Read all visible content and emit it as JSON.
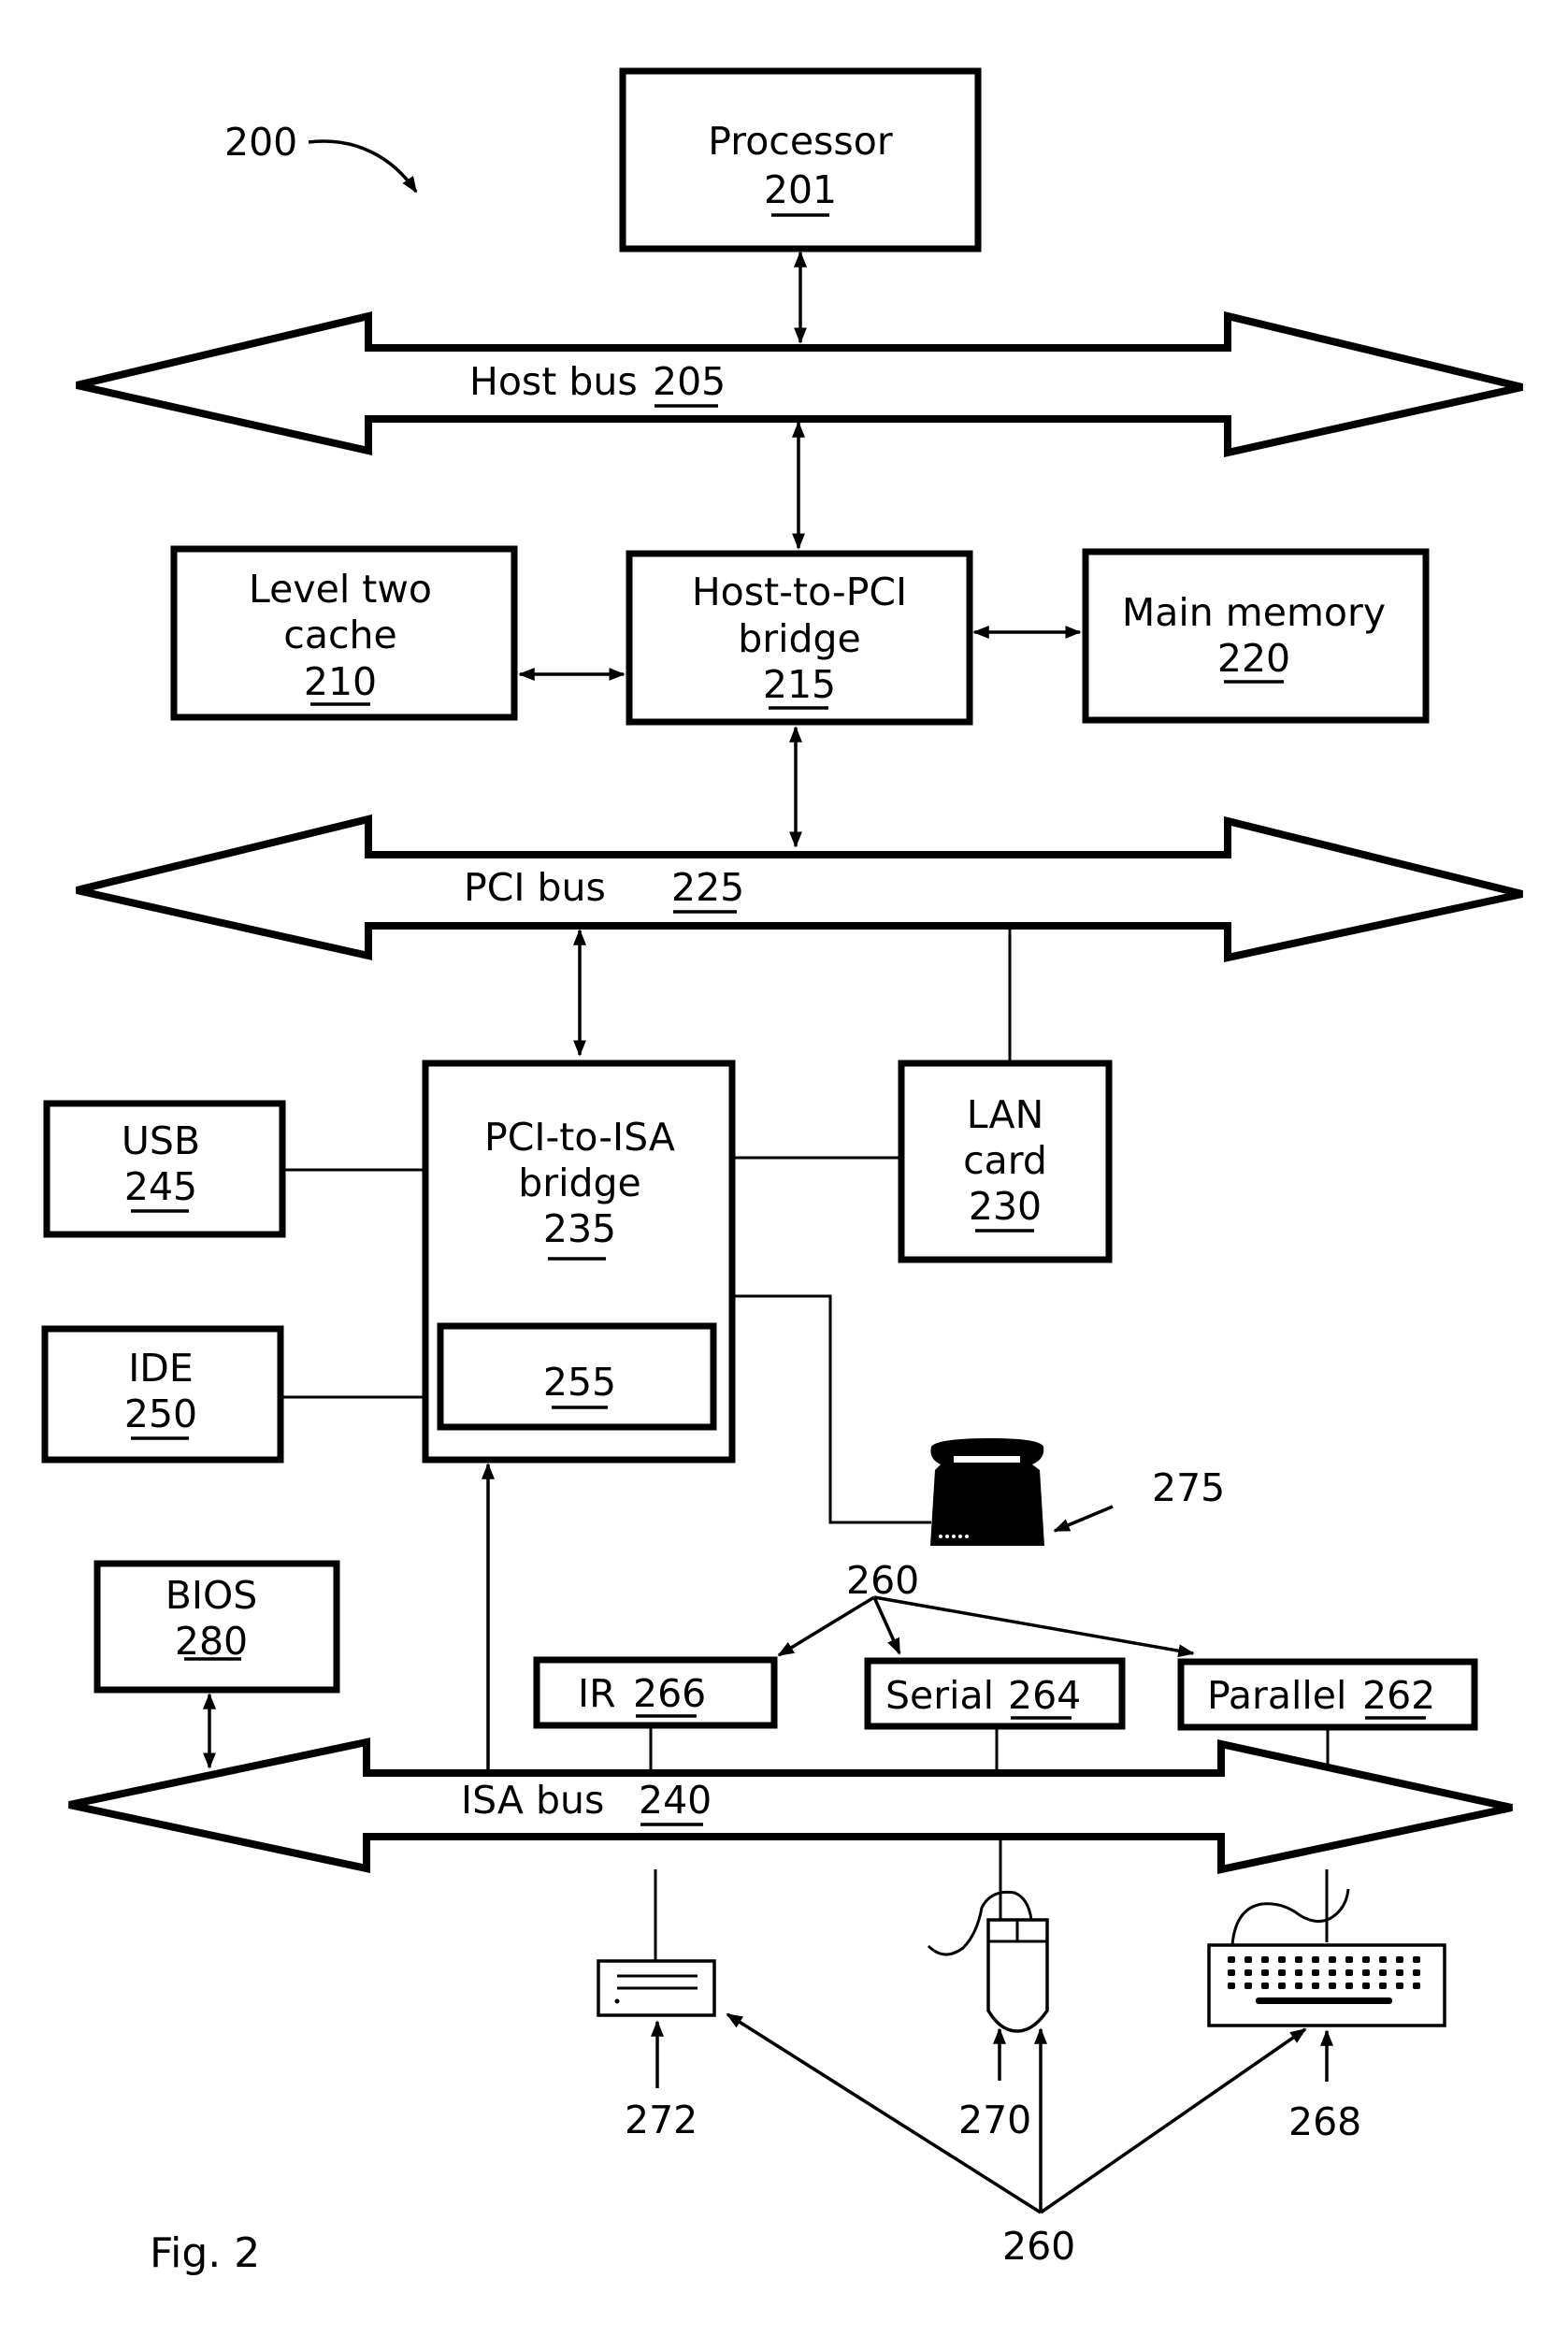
{
  "figure": {
    "caption": "Fig. 2",
    "system_ref": "200"
  },
  "components": {
    "processor": {
      "label": "Processor",
      "ref": "201"
    },
    "host_bus": {
      "label": "Host bus",
      "ref": "205"
    },
    "l2_cache": {
      "line1": "Level two",
      "line2": "cache",
      "ref": "210"
    },
    "host_pci_bridge": {
      "line1": "Host-to-PCI",
      "line2": "bridge",
      "ref": "215"
    },
    "main_memory": {
      "label": "Main memory",
      "ref": "220"
    },
    "pci_bus": {
      "label": "PCI bus",
      "ref": "225"
    },
    "lan_card": {
      "line1": "LAN",
      "line2": "card",
      "ref": "230"
    },
    "pci_isa_bridge": {
      "line1": "PCI-to-ISA",
      "line2": "bridge",
      "ref": "235"
    },
    "isa_bus": {
      "label": "ISA bus",
      "ref": "240"
    },
    "usb": {
      "label": "USB",
      "ref": "245"
    },
    "ide": {
      "label": "IDE",
      "ref": "250"
    },
    "bridge_inner": {
      "ref": "255"
    },
    "io_group_top": {
      "ref": "260"
    },
    "io_group_bottom": {
      "ref": "260"
    },
    "parallel": {
      "label": "Parallel",
      "ref": "262"
    },
    "serial": {
      "label": "Serial",
      "ref": "264"
    },
    "ir": {
      "label": "IR",
      "ref": "266"
    },
    "keyboard": {
      "ref": "268"
    },
    "mouse": {
      "ref": "270"
    },
    "floppy": {
      "ref": "272"
    },
    "telephone": {
      "ref": "275"
    },
    "bios": {
      "label": "BIOS",
      "ref": "280"
    }
  }
}
